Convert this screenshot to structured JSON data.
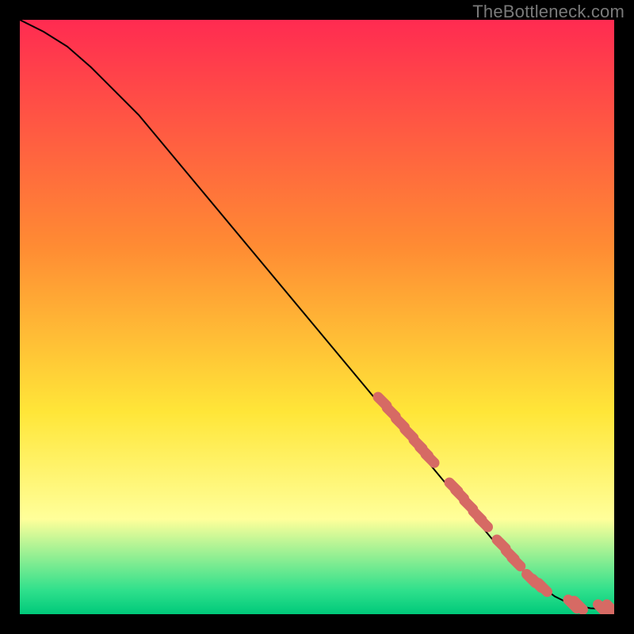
{
  "watermark": "TheBottleneck.com",
  "colors": {
    "black": "#000000",
    "curve": "#000000",
    "marker_fill": "#d66a64",
    "marker_stroke": "#c35a54",
    "grad_top": "#ff2b51",
    "grad_mid_upper": "#ff8b33",
    "grad_mid": "#ffe638",
    "grad_band": "#ffff9a",
    "grad_green": "#2fe08c",
    "grad_bottom": "#00c97a"
  },
  "chart_data": {
    "type": "line",
    "title": "",
    "xlabel": "",
    "ylabel": "",
    "xlim": [
      0,
      100
    ],
    "ylim": [
      0,
      100
    ],
    "series": [
      {
        "name": "curve",
        "x": [
          0,
          4,
          8,
          12,
          20,
          30,
          40,
          50,
          60,
          70,
          75,
          80,
          85,
          88,
          90,
          92,
          94,
          96,
          98,
          100
        ],
        "y": [
          100,
          98,
          95.5,
          92,
          84,
          72,
          60,
          48,
          36,
          24,
          18,
          12,
          7,
          4.5,
          3,
          2,
          1.4,
          1,
          0.9,
          0.9
        ]
      }
    ],
    "markers": {
      "name": "samples",
      "x": [
        61,
        62.5,
        64,
        65.5,
        67,
        68,
        69,
        73,
        74,
        75.5,
        77,
        78,
        81,
        82.5,
        83.5,
        86,
        87,
        88,
        93,
        94,
        98,
        99.5
      ],
      "y": [
        35.8,
        34.0,
        32.2,
        30.4,
        28.6,
        27.4,
        26.2,
        21.4,
        20.2,
        18.4,
        16.6,
        15.4,
        11.8,
        10,
        8.8,
        6,
        5.2,
        4.5,
        1.7,
        1.5,
        0.9,
        0.9
      ]
    }
  }
}
